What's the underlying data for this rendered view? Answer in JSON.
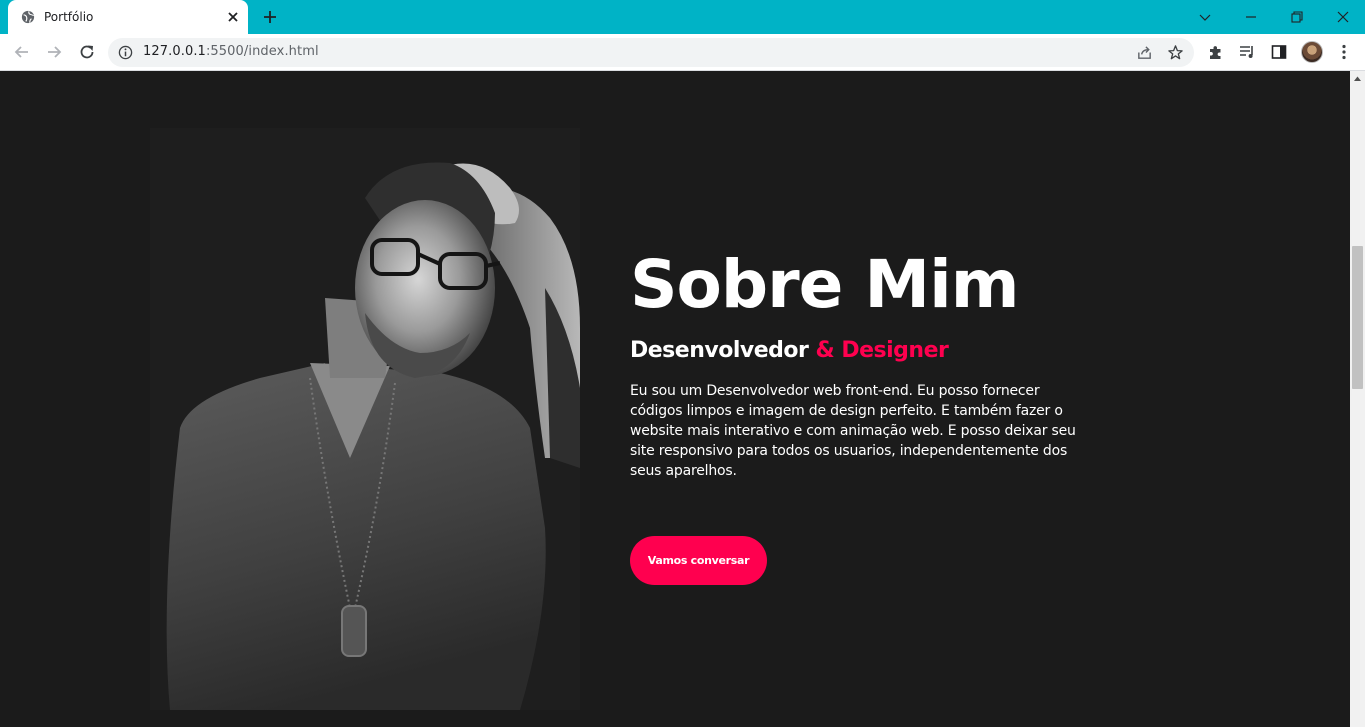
{
  "browser": {
    "tab": {
      "title": "Portfólio"
    },
    "address": {
      "host": "127.0.0.1",
      "rest": ":5500/index.html"
    }
  },
  "about": {
    "heading": "Sobre Mim",
    "subtitle_main": "Desenvolvedor",
    "subtitle_accent": " & Designer",
    "description": "Eu sou um Desenvolvedor web front-end. Eu posso fornecer códigos limpos e imagem de design perfeito. E também fazer o website mais interativo e com animação web. E posso deixar seu site responsivo para todos os usuarios, independentemente dos seus aparelhos.",
    "cta_label": "Vamos conversar"
  },
  "colors": {
    "accent": "#ff004f",
    "background": "#1b1b1b",
    "titlebar": "#00b3c6"
  },
  "icons": [
    "globe-icon",
    "close-icon",
    "plus-icon",
    "chevron-down-icon",
    "minimize-icon",
    "restore-icon",
    "window-close-icon",
    "back-arrow-icon",
    "forward-arrow-icon",
    "reload-icon",
    "info-icon",
    "share-icon",
    "star-icon",
    "extensions-icon",
    "media-icon",
    "side-panel-icon",
    "kebab-menu-icon"
  ]
}
